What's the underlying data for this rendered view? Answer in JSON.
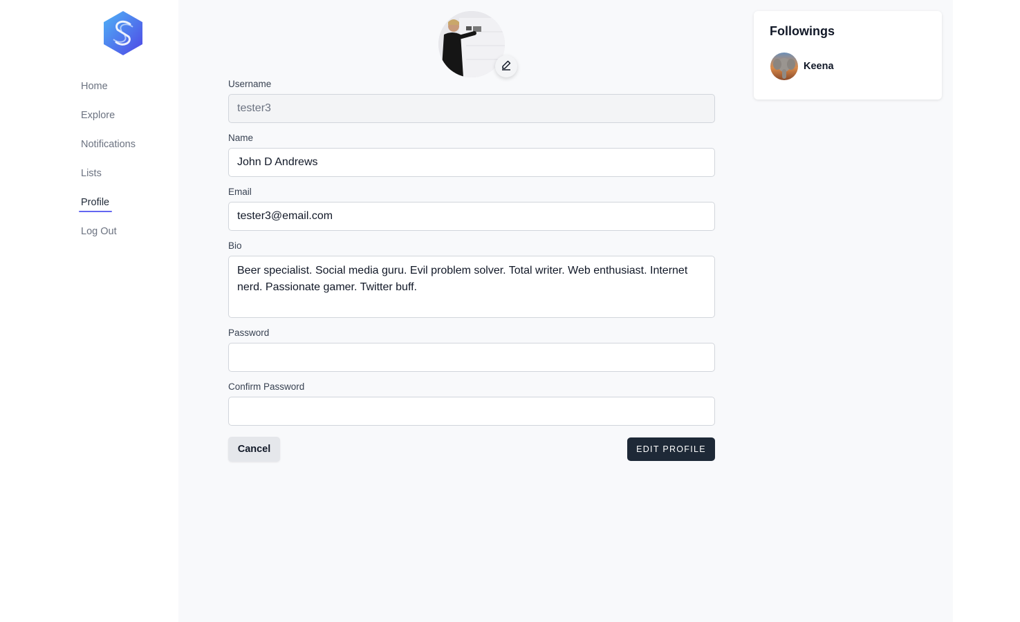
{
  "nav": {
    "items": [
      {
        "label": "Home",
        "active": false
      },
      {
        "label": "Explore",
        "active": false
      },
      {
        "label": "Notifications",
        "active": false
      },
      {
        "label": "Lists",
        "active": false
      },
      {
        "label": "Profile",
        "active": true
      },
      {
        "label": "Log Out",
        "active": false
      }
    ]
  },
  "form": {
    "username": {
      "label": "Username",
      "value": "tester3"
    },
    "name": {
      "label": "Name",
      "value": "John D Andrews"
    },
    "email": {
      "label": "Email",
      "value": "tester3@email.com"
    },
    "bio": {
      "label": "Bio",
      "value": "Beer specialist. Social media guru. Evil problem solver. Total writer. Web enthusiast. Internet nerd. Passionate gamer. Twitter buff."
    },
    "password": {
      "label": "Password",
      "value": ""
    },
    "confirm_password": {
      "label": "Confirm Password",
      "value": ""
    }
  },
  "actions": {
    "cancel_label": "Cancel",
    "submit_label": "EDIT PROFILE"
  },
  "followings": {
    "title": "Followings",
    "items": [
      {
        "name": "Keena"
      }
    ]
  },
  "icons": {
    "logo": "app-logo-icon",
    "edit": "pencil-icon"
  },
  "colors": {
    "accent": "#6366f1",
    "primary_button": "#1e2937",
    "background": "#f8f9fb"
  }
}
